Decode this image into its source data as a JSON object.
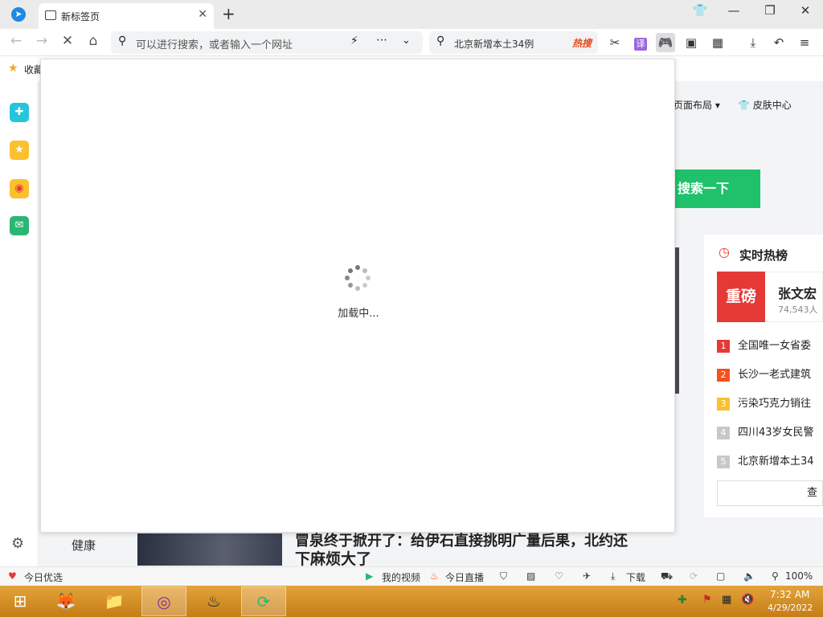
{
  "tab": {
    "title": "新标签页"
  },
  "address_bar": {
    "placeholder": "可以进行搜索，或者输入一个网址"
  },
  "hot_search": {
    "query": "北京新增本土34例",
    "tag": "热搜"
  },
  "toolbar": {
    "translate_label": "译"
  },
  "bookmarks": {
    "label": "收藏"
  },
  "page": {
    "layout_label": "页面布局",
    "skin_label": "皮肤中心",
    "search_button": "搜索一下",
    "health_label": "健康",
    "news_headline_1": "冒泉终于掀开了：给伊石直接挑明广量后果，北约还",
    "news_headline_2": "下麻烦大了"
  },
  "loading": {
    "text": "加载中..."
  },
  "hot_list": {
    "title": "实时热榜",
    "featured_badge": "重磅",
    "featured_title": "张文宏",
    "featured_count": "74,543人",
    "items": [
      {
        "rank": "1",
        "text": "全国唯一女省委",
        "color": "#e53935"
      },
      {
        "rank": "2",
        "text": "长沙一老式建筑",
        "color": "#f4511e"
      },
      {
        "rank": "3",
        "text": "污染巧克力销往",
        "color": "#fbc02d"
      },
      {
        "rank": "4",
        "text": "四川43岁女民警",
        "color": "#c8c8c8"
      },
      {
        "rank": "5",
        "text": "北京新增本土34",
        "color": "#c8c8c8"
      }
    ],
    "more_button": "查"
  },
  "status_bar": {
    "daily_pick": "今日优选",
    "my_video": "我的视频",
    "live": "今日直播",
    "download": "下载",
    "zoom": "100%"
  },
  "taskbar": {
    "time": "7:32 AM",
    "date": "4/29/2022"
  }
}
